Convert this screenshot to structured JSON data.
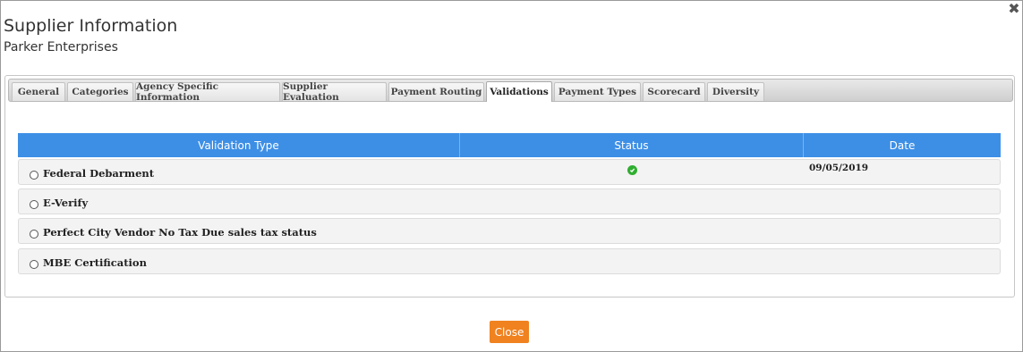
{
  "dialog": {
    "title": "Supplier Information",
    "subtitle": "Parker Enterprises",
    "close_icon": "close-icon"
  },
  "tabs": [
    {
      "label": "General"
    },
    {
      "label": "Categories"
    },
    {
      "label": "Agency Specific Information"
    },
    {
      "label": "Supplier Evaluation"
    },
    {
      "label": "Payment Routing"
    },
    {
      "label": "Validations",
      "active": true
    },
    {
      "label": "Payment Types"
    },
    {
      "label": "Scorecard"
    },
    {
      "label": "Diversity"
    }
  ],
  "table": {
    "headers": {
      "type": "Validation Type",
      "status": "Status",
      "date": "Date"
    },
    "rows": [
      {
        "type": "Federal Debarment",
        "status_icon": "check-circle-icon",
        "date": "09/05/2019"
      },
      {
        "type": "E-Verify",
        "status_icon": "",
        "date": ""
      },
      {
        "type": "Perfect City Vendor No Tax Due sales tax status",
        "status_icon": "",
        "date": ""
      },
      {
        "type": "MBE Certification",
        "status_icon": "",
        "date": ""
      }
    ]
  },
  "footer": {
    "close_label": "Close"
  },
  "colors": {
    "header_blue": "#3d8fe6",
    "close_orange": "#f0821f",
    "status_green": "#2fae2f"
  }
}
